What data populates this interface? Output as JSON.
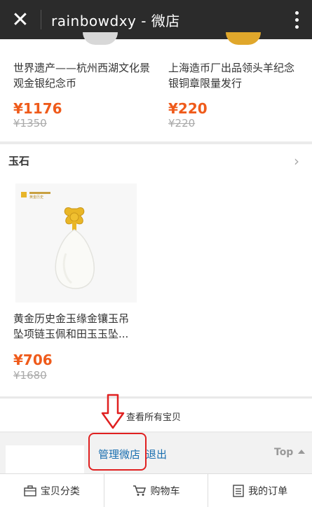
{
  "app": {
    "title": "rainbowdxy - 微店",
    "close_glyph": "✕"
  },
  "products_top": [
    {
      "title": "世界遗产——杭州西湖文化景观金银纪念币",
      "price": "¥1176",
      "old_price": "¥1350"
    },
    {
      "title": "上海造币厂出品领头羊纪念银铜章限量发行",
      "price": "¥220",
      "old_price": "¥220"
    }
  ],
  "section": {
    "label": "玉石",
    "chevron": "›"
  },
  "jade_product": {
    "title_line1": "黄金历史金玉缘金镶玉吊",
    "title_line2": "坠项链玉佩和田玉玉坠...",
    "price": "¥706",
    "old_price": "¥1680",
    "brand": "黄金历史"
  },
  "view_all": "查看所有宝贝",
  "footer": {
    "manage": "管理微店",
    "logout": "退出",
    "top": "Top"
  },
  "tabbar": [
    {
      "label": "宝贝分类",
      "icon": "category-icon"
    },
    {
      "label": "购物车",
      "icon": "cart-icon"
    },
    {
      "label": "我的订单",
      "icon": "order-icon"
    }
  ],
  "colors": {
    "price": "#ef5b1b",
    "link": "#1a6fb0",
    "annotation": "#e02020",
    "topbar": "#2b2b2b"
  }
}
